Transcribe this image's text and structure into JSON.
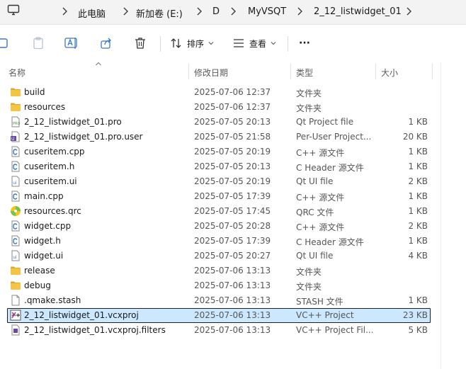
{
  "breadcrumb": {
    "items": [
      "此电脑",
      "新加卷 (E:)",
      "D",
      "MyVSQT",
      "2_12_listwidget_01"
    ]
  },
  "toolbar": {
    "sort_label": "排序",
    "view_label": "查看",
    "more_label": "···"
  },
  "columns": {
    "name": "名称",
    "date": "修改日期",
    "type": "类型",
    "size": "大小"
  },
  "files": [
    {
      "name": "build",
      "date": "2025-07-06 12:37",
      "type": "文件夹",
      "size": "",
      "icon": "folder-icon"
    },
    {
      "name": "resources",
      "date": "2025-07-06 12:37",
      "type": "文件夹",
      "size": "",
      "icon": "folder-icon"
    },
    {
      "name": "2_12_listwidget_01.pro",
      "date": "2025-07-05 20:13",
      "type": "Qt Project file",
      "size": "1 KB",
      "icon": "qt-pro-file-icon"
    },
    {
      "name": "2_12_listwidget_01.pro.user",
      "date": "2025-07-05 21:58",
      "type": "Per-User Project...",
      "size": "20 KB",
      "icon": "user-file-icon"
    },
    {
      "name": "cuseritem.cpp",
      "date": "2025-07-05 20:19",
      "type": "C++ 源文件",
      "size": "1 KB",
      "icon": "c-source-icon"
    },
    {
      "name": "cuseritem.h",
      "date": "2025-07-05 20:13",
      "type": "C Header 源文件",
      "size": "1 KB",
      "icon": "c-source-icon"
    },
    {
      "name": "cuseritem.ui",
      "date": "2025-07-05 20:19",
      "type": "Qt UI file",
      "size": "2 KB",
      "icon": "ui-file-icon"
    },
    {
      "name": "main.cpp",
      "date": "2025-07-05 17:39",
      "type": "C++ 源文件",
      "size": "1 KB",
      "icon": "c-source-icon"
    },
    {
      "name": "resources.qrc",
      "date": "2025-07-05 17:45",
      "type": "QRC 文件",
      "size": "1 KB",
      "icon": "qrc-icon"
    },
    {
      "name": "widget.cpp",
      "date": "2025-07-05 20:28",
      "type": "C++ 源文件",
      "size": "2 KB",
      "icon": "c-source-icon"
    },
    {
      "name": "widget.h",
      "date": "2025-07-05 17:39",
      "type": "C Header 源文件",
      "size": "1 KB",
      "icon": "c-source-icon"
    },
    {
      "name": "widget.ui",
      "date": "2025-07-05 20:27",
      "type": "Qt UI file",
      "size": "4 KB",
      "icon": "ui-file-icon"
    },
    {
      "name": "release",
      "date": "2025-07-06 13:13",
      "type": "文件夹",
      "size": "",
      "icon": "folder-icon"
    },
    {
      "name": "debug",
      "date": "2025-07-06 13:13",
      "type": "文件夹",
      "size": "",
      "icon": "folder-icon"
    },
    {
      "name": ".qmake.stash",
      "date": "2025-07-06 13:13",
      "type": "STASH 文件",
      "size": "1 KB",
      "icon": "blank-file-icon"
    },
    {
      "name": "2_12_listwidget_01.vcxproj",
      "date": "2025-07-06 13:13",
      "type": "VC++ Project",
      "size": "23 KB",
      "icon": "vcxproj-icon",
      "selected": true
    },
    {
      "name": "2_12_listwidget_01.vcxproj.filters",
      "date": "2025-07-06 13:13",
      "type": "VC++ Project Fil...",
      "size": "5 KB",
      "icon": "filters-file-icon"
    }
  ],
  "colors": {
    "folder": "#f4c542",
    "folder_dark": "#e0a82e",
    "selection_bg": "#cce8ff",
    "c_icon": "#3b78c4",
    "qrc_green": "#7cc24a",
    "qrc_yellow": "#f5c518"
  }
}
